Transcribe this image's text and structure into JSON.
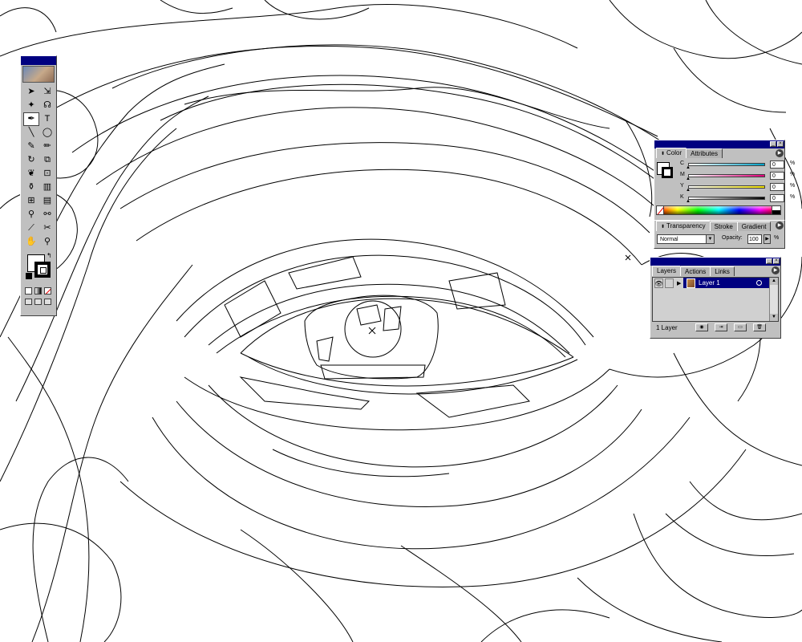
{
  "toolbox": {
    "tools": [
      {
        "name": "selection-tool",
        "icon": "arrow-icon",
        "glyph": "➤"
      },
      {
        "name": "direct-selection-tool",
        "icon": "hollow-arrow-icon",
        "glyph": "⇲"
      },
      {
        "name": "magic-wand-tool",
        "icon": "wand-icon",
        "glyph": "✦"
      },
      {
        "name": "lasso-tool",
        "icon": "lasso-icon",
        "glyph": "☊"
      },
      {
        "name": "pen-tool",
        "icon": "pen-icon",
        "glyph": "✒"
      },
      {
        "name": "type-tool",
        "icon": "type-icon",
        "glyph": "T"
      },
      {
        "name": "line-tool",
        "icon": "line-icon",
        "glyph": "╲"
      },
      {
        "name": "ellipse-tool",
        "icon": "ellipse-icon",
        "glyph": "◯"
      },
      {
        "name": "paintbrush-tool",
        "icon": "brush-icon",
        "glyph": "✎"
      },
      {
        "name": "pencil-tool",
        "icon": "pencil-icon",
        "glyph": "✏"
      },
      {
        "name": "rotate-tool",
        "icon": "rotate-icon",
        "glyph": "↻"
      },
      {
        "name": "scale-tool",
        "icon": "scale-icon",
        "glyph": "⧉"
      },
      {
        "name": "warp-tool",
        "icon": "warp-icon",
        "glyph": "❦"
      },
      {
        "name": "free-transform-tool",
        "icon": "transform-icon",
        "glyph": "⊡"
      },
      {
        "name": "symbol-sprayer-tool",
        "icon": "sprayer-icon",
        "glyph": "⚱"
      },
      {
        "name": "graph-tool",
        "icon": "graph-icon",
        "glyph": "▥"
      },
      {
        "name": "mesh-tool",
        "icon": "mesh-icon",
        "glyph": "⊞"
      },
      {
        "name": "gradient-tool",
        "icon": "gradient-icon",
        "glyph": "▤"
      },
      {
        "name": "eyedropper-tool",
        "icon": "eyedropper-icon",
        "glyph": "⚲"
      },
      {
        "name": "blend-tool",
        "icon": "blend-icon",
        "glyph": "⚯"
      },
      {
        "name": "slice-tool",
        "icon": "slice-icon",
        "glyph": "⟋"
      },
      {
        "name": "scissors-tool",
        "icon": "scissors-icon",
        "glyph": "✂"
      },
      {
        "name": "hand-tool",
        "icon": "hand-icon",
        "glyph": "✋"
      },
      {
        "name": "zoom-tool",
        "icon": "zoom-icon",
        "glyph": "⚲"
      }
    ],
    "active_tool": "pen-tool"
  },
  "color_palette": {
    "tabs": [
      {
        "label": "Color",
        "active": true
      },
      {
        "label": "Attributes",
        "active": false
      }
    ],
    "sliders": [
      {
        "label": "C",
        "value": "0",
        "color_from": "#ffffff",
        "color_to": "#00a0c6"
      },
      {
        "label": "M",
        "value": "0",
        "color_from": "#ffffff",
        "color_to": "#e0007a"
      },
      {
        "label": "Y",
        "value": "0",
        "color_from": "#ffffff",
        "color_to": "#f0e000"
      },
      {
        "label": "K",
        "value": "0",
        "color_from": "#ffffff",
        "color_to": "#000000"
      }
    ],
    "unit": "%"
  },
  "transparency_palette": {
    "tabs": [
      {
        "label": "Transparency",
        "active": true
      },
      {
        "label": "Stroke",
        "active": false
      },
      {
        "label": "Gradient",
        "active": false
      }
    ],
    "blend_mode": "Normal",
    "opacity_label": "Opacity:",
    "opacity_value": "100",
    "unit": "%"
  },
  "layers_palette": {
    "tabs": [
      {
        "label": "Layers",
        "active": true
      },
      {
        "label": "Actions",
        "active": false
      },
      {
        "label": "Links",
        "active": false
      }
    ],
    "layers": [
      {
        "name": "Layer 1",
        "visible": true,
        "selected": true
      }
    ],
    "count_label": "1 Layer"
  },
  "colors": {
    "titlebar": "#000080",
    "panel": "#c0c0c0",
    "selection": "#000080"
  }
}
